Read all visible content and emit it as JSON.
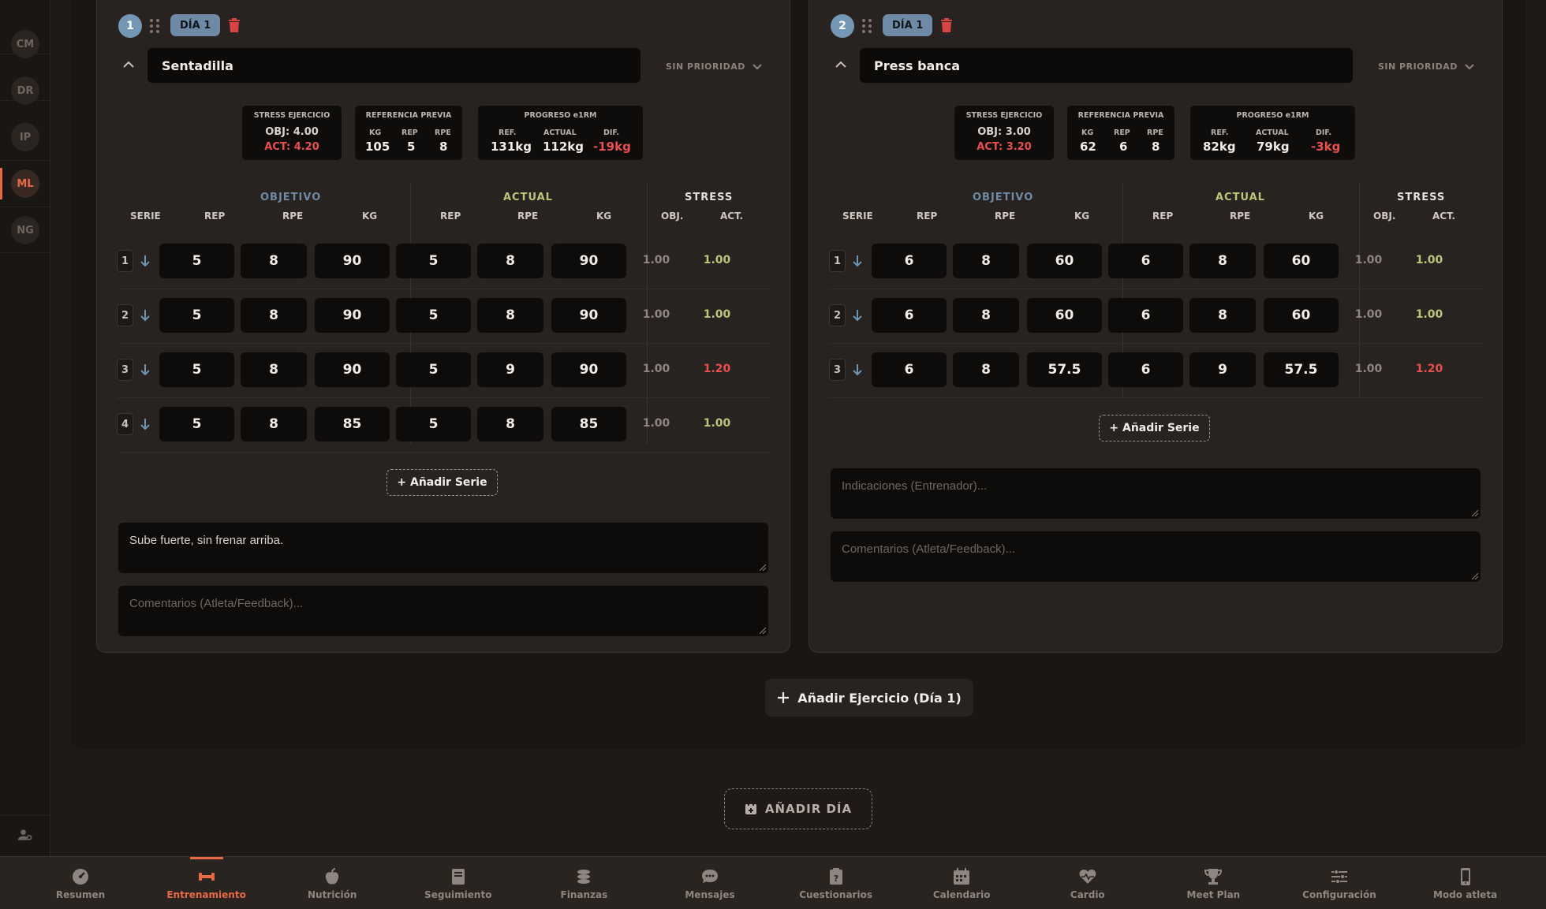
{
  "sidebar": {
    "items": [
      "CM",
      "DR",
      "IP",
      "ML",
      "NG"
    ],
    "active": "ML"
  },
  "labels": {
    "stress_ejercicio": "STRESS EJERCICIO",
    "referencia_previa": "REFERENCIA PREVIA",
    "progreso": "PROGRESO e1RM",
    "kg": "KG",
    "rep": "REP",
    "rpe": "RPE",
    "ref": "REF.",
    "actual": "ACTUAL",
    "dif": "DIF.",
    "objetivo_group": "OBJETIVO",
    "actual_group": "ACTUAL",
    "stress_group": "STRESS",
    "serie": "SERIE",
    "obj": "OBJ.",
    "act": "ACT.",
    "add_serie": "+ Añadir Serie",
    "notes_placeholder": "Indicaciones (Entrenador)...",
    "comments_placeholder": "Comentarios (Atleta/Feedback)...",
    "priority": "SIN PRIORIDAD"
  },
  "exercises": [
    {
      "number": "1",
      "day": "DÍA 1",
      "name": "Sentadilla",
      "stress_obj": "OBJ: 4.00",
      "stress_act": "ACT: 4.20",
      "ref_kg": "105",
      "ref_rep": "5",
      "ref_rpe": "8",
      "prog_ref": "131kg",
      "prog_actual": "112kg",
      "prog_dif": "-19kg",
      "sets": [
        {
          "n": "1",
          "obj_rep": "5",
          "obj_rpe": "8",
          "obj_kg": "90",
          "act_rep": "5",
          "act_rpe": "8",
          "act_kg": "90",
          "s_obj": "1.00",
          "s_act": "1.00"
        },
        {
          "n": "2",
          "obj_rep": "5",
          "obj_rpe": "8",
          "obj_kg": "90",
          "act_rep": "5",
          "act_rpe": "8",
          "act_kg": "90",
          "s_obj": "1.00",
          "s_act": "1.00"
        },
        {
          "n": "3",
          "obj_rep": "5",
          "obj_rpe": "8",
          "obj_kg": "90",
          "act_rep": "5",
          "act_rpe": "9",
          "act_kg": "90",
          "s_obj": "1.00",
          "s_act": "1.20"
        },
        {
          "n": "4",
          "obj_rep": "5",
          "obj_rpe": "8",
          "obj_kg": "85",
          "act_rep": "5",
          "act_rpe": "8",
          "act_kg": "85",
          "s_obj": "1.00",
          "s_act": "1.00"
        }
      ],
      "notes": "Sube fuerte, sin frenar arriba.",
      "comments": ""
    },
    {
      "number": "2",
      "day": "DÍA 1",
      "name": "Press banca",
      "stress_obj": "OBJ: 3.00",
      "stress_act": "ACT: 3.20",
      "ref_kg": "62",
      "ref_rep": "6",
      "ref_rpe": "8",
      "prog_ref": "82kg",
      "prog_actual": "79kg",
      "prog_dif": "-3kg",
      "sets": [
        {
          "n": "1",
          "obj_rep": "6",
          "obj_rpe": "8",
          "obj_kg": "60",
          "act_rep": "6",
          "act_rpe": "8",
          "act_kg": "60",
          "s_obj": "1.00",
          "s_act": "1.00"
        },
        {
          "n": "2",
          "obj_rep": "6",
          "obj_rpe": "8",
          "obj_kg": "60",
          "act_rep": "6",
          "act_rpe": "8",
          "act_kg": "60",
          "s_obj": "1.00",
          "s_act": "1.00"
        },
        {
          "n": "3",
          "obj_rep": "6",
          "obj_rpe": "8",
          "obj_kg": "57.5",
          "act_rep": "6",
          "act_rpe": "9",
          "act_kg": "57.5",
          "s_obj": "1.00",
          "s_act": "1.20"
        }
      ],
      "notes": "",
      "comments": ""
    }
  ],
  "add_exercise": "Añadir Ejercicio (Día 1)",
  "add_day": "AÑADIR DÍA",
  "colors": {
    "accent": "#e86a45",
    "red": "#e85050",
    "green": "#b9c77b",
    "blue": "#6e8aa6"
  },
  "nav": [
    {
      "label": "Resumen",
      "icon": "gauge-icon"
    },
    {
      "label": "Entrenamiento",
      "icon": "dumbbell-icon"
    },
    {
      "label": "Nutrición",
      "icon": "apple-icon"
    },
    {
      "label": "Seguimiento",
      "icon": "book-icon"
    },
    {
      "label": "Finanzas",
      "icon": "coins-icon"
    },
    {
      "label": "Mensajes",
      "icon": "chat-icon"
    },
    {
      "label": "Cuestionarios",
      "icon": "clipboard-icon"
    },
    {
      "label": "Calendario",
      "icon": "calendar-icon"
    },
    {
      "label": "Cardio",
      "icon": "heart-pulse-icon"
    },
    {
      "label": "Meet Plan",
      "icon": "trophy-icon"
    },
    {
      "label": "Configuración",
      "icon": "sliders-icon"
    },
    {
      "label": "Modo atleta",
      "icon": "mobile-icon"
    }
  ],
  "nav_active": "Entrenamiento"
}
